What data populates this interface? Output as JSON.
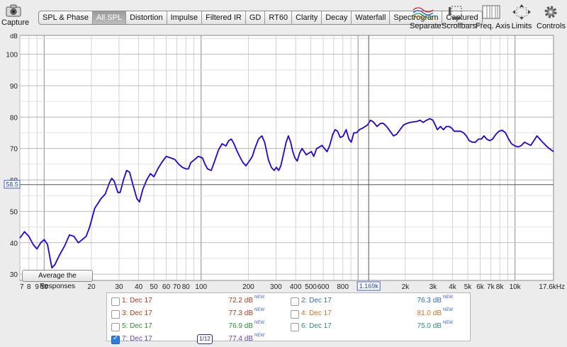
{
  "toolbar": {
    "capture_label": "Capture",
    "tabs": [
      {
        "label": "SPL & Phase",
        "active": false
      },
      {
        "label": "All SPL",
        "active": true
      },
      {
        "label": "Distortion",
        "active": false
      },
      {
        "label": "Impulse",
        "active": false
      },
      {
        "label": "Filtered IR",
        "active": false
      },
      {
        "label": "GD",
        "active": false
      },
      {
        "label": "RT60",
        "active": false
      },
      {
        "label": "Clarity",
        "active": false
      },
      {
        "label": "Decay",
        "active": false
      },
      {
        "label": "Waterfall",
        "active": false
      },
      {
        "label": "Spectrogram",
        "active": false
      },
      {
        "label": "Captured",
        "active": false
      }
    ],
    "right_tools": [
      {
        "label": "Separate",
        "icon": "separate-icon"
      },
      {
        "label": "Scrollbars",
        "icon": "scrollbars-icon"
      },
      {
        "label": "Freq. Axis",
        "icon": "freq-axis-icon"
      },
      {
        "label": "Limits",
        "icon": "limits-icon"
      },
      {
        "label": "Controls",
        "icon": "gear-icon"
      }
    ]
  },
  "plot": {
    "y_unit": "dB",
    "cursor_y_label": "58.5",
    "cursor_x_label": "1.169k",
    "cursor_y_value": 58.5,
    "cursor_x_value": 1169
  },
  "average_button_label": "Average the Responses",
  "legend": {
    "rows": [
      {
        "left": {
          "label": "1: Dec 17",
          "value": "72.2 dB",
          "new": "NEW",
          "color": "#b03a1a",
          "checked": false
        },
        "right": {
          "label": "2: Dec 17",
          "value": "76.3 dB",
          "new": "NEW",
          "color": "#2f69c8",
          "checked": false
        }
      },
      {
        "left": {
          "label": "3: Dec 17",
          "value": "77.3 dB",
          "new": "NEW",
          "color": "#b03a1a",
          "checked": false
        },
        "right": {
          "label": "4: Dec 17",
          "value": "81.0 dB",
          "new": "NEW",
          "color": "#d07020",
          "checked": false
        }
      },
      {
        "left": {
          "label": "5: Dec 17",
          "value": "76.9 dB",
          "new": "NEW",
          "color": "#2e8a2e",
          "checked": false
        },
        "right": {
          "label": "6: Dec 17",
          "value": "75.0 dB",
          "new": "NEW",
          "color": "#2e8a80",
          "checked": false
        }
      },
      {
        "left": {
          "label": "7: Dec 17",
          "value": "77.4 dB",
          "new": "NEW",
          "color": "#6a3cc0",
          "checked": true
        },
        "stepper": "1/12"
      }
    ]
  },
  "colors": {
    "trace": "#2200dd",
    "accent": "#2f7de1",
    "grid": "#9a9a9a"
  },
  "chart_data": {
    "type": "line",
    "xlabel": "",
    "ylabel": "dB",
    "x_scale": "log",
    "xlim": [
      7,
      17600
    ],
    "ylim": [
      28,
      106
    ],
    "y_ticks": [
      30,
      40,
      50,
      60,
      70,
      80,
      90,
      100
    ],
    "x_ticks": [
      {
        "v": 7,
        "label": "7"
      },
      {
        "v": 8,
        "label": "8"
      },
      {
        "v": 9,
        "label": "9"
      },
      {
        "v": 10,
        "label": "10"
      },
      {
        "v": 20,
        "label": "20"
      },
      {
        "v": 30,
        "label": "30"
      },
      {
        "v": 40,
        "label": "40"
      },
      {
        "v": 50,
        "label": "50"
      },
      {
        "v": 60,
        "label": "60"
      },
      {
        "v": 70,
        "label": "70"
      },
      {
        "v": 80,
        "label": "80"
      },
      {
        "v": 100,
        "label": "100"
      },
      {
        "v": 200,
        "label": "200"
      },
      {
        "v": 300,
        "label": "300"
      },
      {
        "v": 400,
        "label": "400"
      },
      {
        "v": 500,
        "label": "500"
      },
      {
        "v": 600,
        "label": "600"
      },
      {
        "v": 800,
        "label": "800"
      },
      {
        "v": 2000,
        "label": "2k"
      },
      {
        "v": 3000,
        "label": "3k"
      },
      {
        "v": 4000,
        "label": "4k"
      },
      {
        "v": 5000,
        "label": "5k"
      },
      {
        "v": 6000,
        "label": "6k"
      },
      {
        "v": 7000,
        "label": "7k"
      },
      {
        "v": 8000,
        "label": "8k"
      },
      {
        "v": 10000,
        "label": "10k"
      },
      {
        "v": 17600,
        "label": "17.6kHz"
      }
    ],
    "series": [
      {
        "color": "#2200dd",
        "points": [
          [
            7,
            41.5
          ],
          [
            7.5,
            43.5
          ],
          [
            8,
            42
          ],
          [
            8.5,
            39.5
          ],
          [
            9,
            38
          ],
          [
            9.5,
            40
          ],
          [
            10,
            41
          ],
          [
            10.5,
            39.5
          ],
          [
            11.2,
            32
          ],
          [
            11.7,
            33
          ],
          [
            12.5,
            36
          ],
          [
            13.5,
            39
          ],
          [
            14.5,
            42.5
          ],
          [
            15.5,
            42
          ],
          [
            16.5,
            40
          ],
          [
            17.5,
            41
          ],
          [
            18.5,
            42
          ],
          [
            19.5,
            45
          ],
          [
            21,
            51
          ],
          [
            23,
            54
          ],
          [
            24.5,
            55.5
          ],
          [
            26,
            59
          ],
          [
            27,
            60.5
          ],
          [
            28,
            59.5
          ],
          [
            29.5,
            56
          ],
          [
            30.5,
            56
          ],
          [
            32,
            60
          ],
          [
            33.5,
            63
          ],
          [
            35,
            62.5
          ],
          [
            37,
            58
          ],
          [
            39,
            54
          ],
          [
            40.5,
            53
          ],
          [
            42.5,
            57
          ],
          [
            45,
            60
          ],
          [
            47.5,
            62
          ],
          [
            50,
            61
          ],
          [
            53,
            63.5
          ],
          [
            56,
            65.5
          ],
          [
            60,
            67.5
          ],
          [
            64,
            67
          ],
          [
            68,
            66.5
          ],
          [
            72,
            65
          ],
          [
            76,
            64
          ],
          [
            80,
            63.5
          ],
          [
            83,
            63.5
          ],
          [
            86,
            65.5
          ],
          [
            91,
            66.5
          ],
          [
            96,
            67.5
          ],
          [
            102,
            67
          ],
          [
            106,
            65
          ],
          [
            110,
            63.5
          ],
          [
            116,
            63
          ],
          [
            122,
            66
          ],
          [
            129,
            69.5
          ],
          [
            136,
            71.5
          ],
          [
            144,
            70.8
          ],
          [
            150,
            72.5
          ],
          [
            156,
            73
          ],
          [
            162,
            71.5
          ],
          [
            170,
            69
          ],
          [
            178,
            67
          ],
          [
            185,
            65.5
          ],
          [
            193,
            64.5
          ],
          [
            203,
            66
          ],
          [
            212,
            67.5
          ],
          [
            220,
            70
          ],
          [
            232,
            73
          ],
          [
            244,
            74
          ],
          [
            254,
            72
          ],
          [
            268,
            66.5
          ],
          [
            280,
            64
          ],
          [
            292,
            63
          ],
          [
            302,
            64
          ],
          [
            312,
            63
          ],
          [
            322,
            64.5
          ],
          [
            336,
            68.5
          ],
          [
            348,
            72
          ],
          [
            360,
            74
          ],
          [
            372,
            72
          ],
          [
            384,
            69
          ],
          [
            396,
            67
          ],
          [
            410,
            66
          ],
          [
            424,
            68.5
          ],
          [
            440,
            70
          ],
          [
            454,
            69
          ],
          [
            468,
            68
          ],
          [
            486,
            68.5
          ],
          [
            504,
            69
          ],
          [
            522,
            67.5
          ],
          [
            545,
            70
          ],
          [
            568,
            70.5
          ],
          [
            590,
            71
          ],
          [
            610,
            70
          ],
          [
            635,
            69
          ],
          [
            660,
            71
          ],
          [
            690,
            74.5
          ],
          [
            715,
            76
          ],
          [
            740,
            75.5
          ],
          [
            770,
            73.5
          ],
          [
            805,
            74
          ],
          [
            840,
            76
          ],
          [
            875,
            73
          ],
          [
            905,
            72
          ],
          [
            940,
            75
          ],
          [
            980,
            75
          ],
          [
            1020,
            76
          ],
          [
            1070,
            76.5
          ],
          [
            1110,
            77
          ],
          [
            1150,
            77.5
          ],
          [
            1200,
            79
          ],
          [
            1250,
            78.5
          ],
          [
            1320,
            77
          ],
          [
            1390,
            78
          ],
          [
            1450,
            78
          ],
          [
            1520,
            77
          ],
          [
            1600,
            75.5
          ],
          [
            1680,
            74
          ],
          [
            1760,
            74.5
          ],
          [
            1850,
            76
          ],
          [
            1950,
            77.5
          ],
          [
            2050,
            78
          ],
          [
            2150,
            78.3
          ],
          [
            2260,
            78.5
          ],
          [
            2370,
            78.6
          ],
          [
            2480,
            79
          ],
          [
            2600,
            78.3
          ],
          [
            2730,
            79
          ],
          [
            2870,
            79.5
          ],
          [
            3000,
            79
          ],
          [
            3100,
            77.5
          ],
          [
            3200,
            76
          ],
          [
            3350,
            77
          ],
          [
            3500,
            76
          ],
          [
            3650,
            77
          ],
          [
            3800,
            77
          ],
          [
            3950,
            76.5
          ],
          [
            4100,
            75.5
          ],
          [
            4300,
            75.5
          ],
          [
            4500,
            75.5
          ],
          [
            4700,
            75
          ],
          [
            4900,
            74
          ],
          [
            5100,
            72.5
          ],
          [
            5350,
            72
          ],
          [
            5600,
            72
          ],
          [
            5850,
            73
          ],
          [
            6100,
            73
          ],
          [
            6350,
            74
          ],
          [
            6600,
            73
          ],
          [
            6900,
            72.5
          ],
          [
            7200,
            73
          ],
          [
            7550,
            74.5
          ],
          [
            7900,
            75.5
          ],
          [
            8300,
            75.8
          ],
          [
            8700,
            75
          ],
          [
            9100,
            73
          ],
          [
            9500,
            71.5
          ],
          [
            10000,
            70.8
          ],
          [
            10500,
            70.5
          ],
          [
            11000,
            71
          ],
          [
            11500,
            72
          ],
          [
            12000,
            71.5
          ],
          [
            12600,
            71
          ],
          [
            13200,
            72.5
          ],
          [
            13800,
            74
          ],
          [
            14400,
            73
          ],
          [
            15000,
            72
          ],
          [
            15700,
            71
          ],
          [
            16500,
            70
          ],
          [
            17600,
            69
          ]
        ]
      }
    ]
  }
}
